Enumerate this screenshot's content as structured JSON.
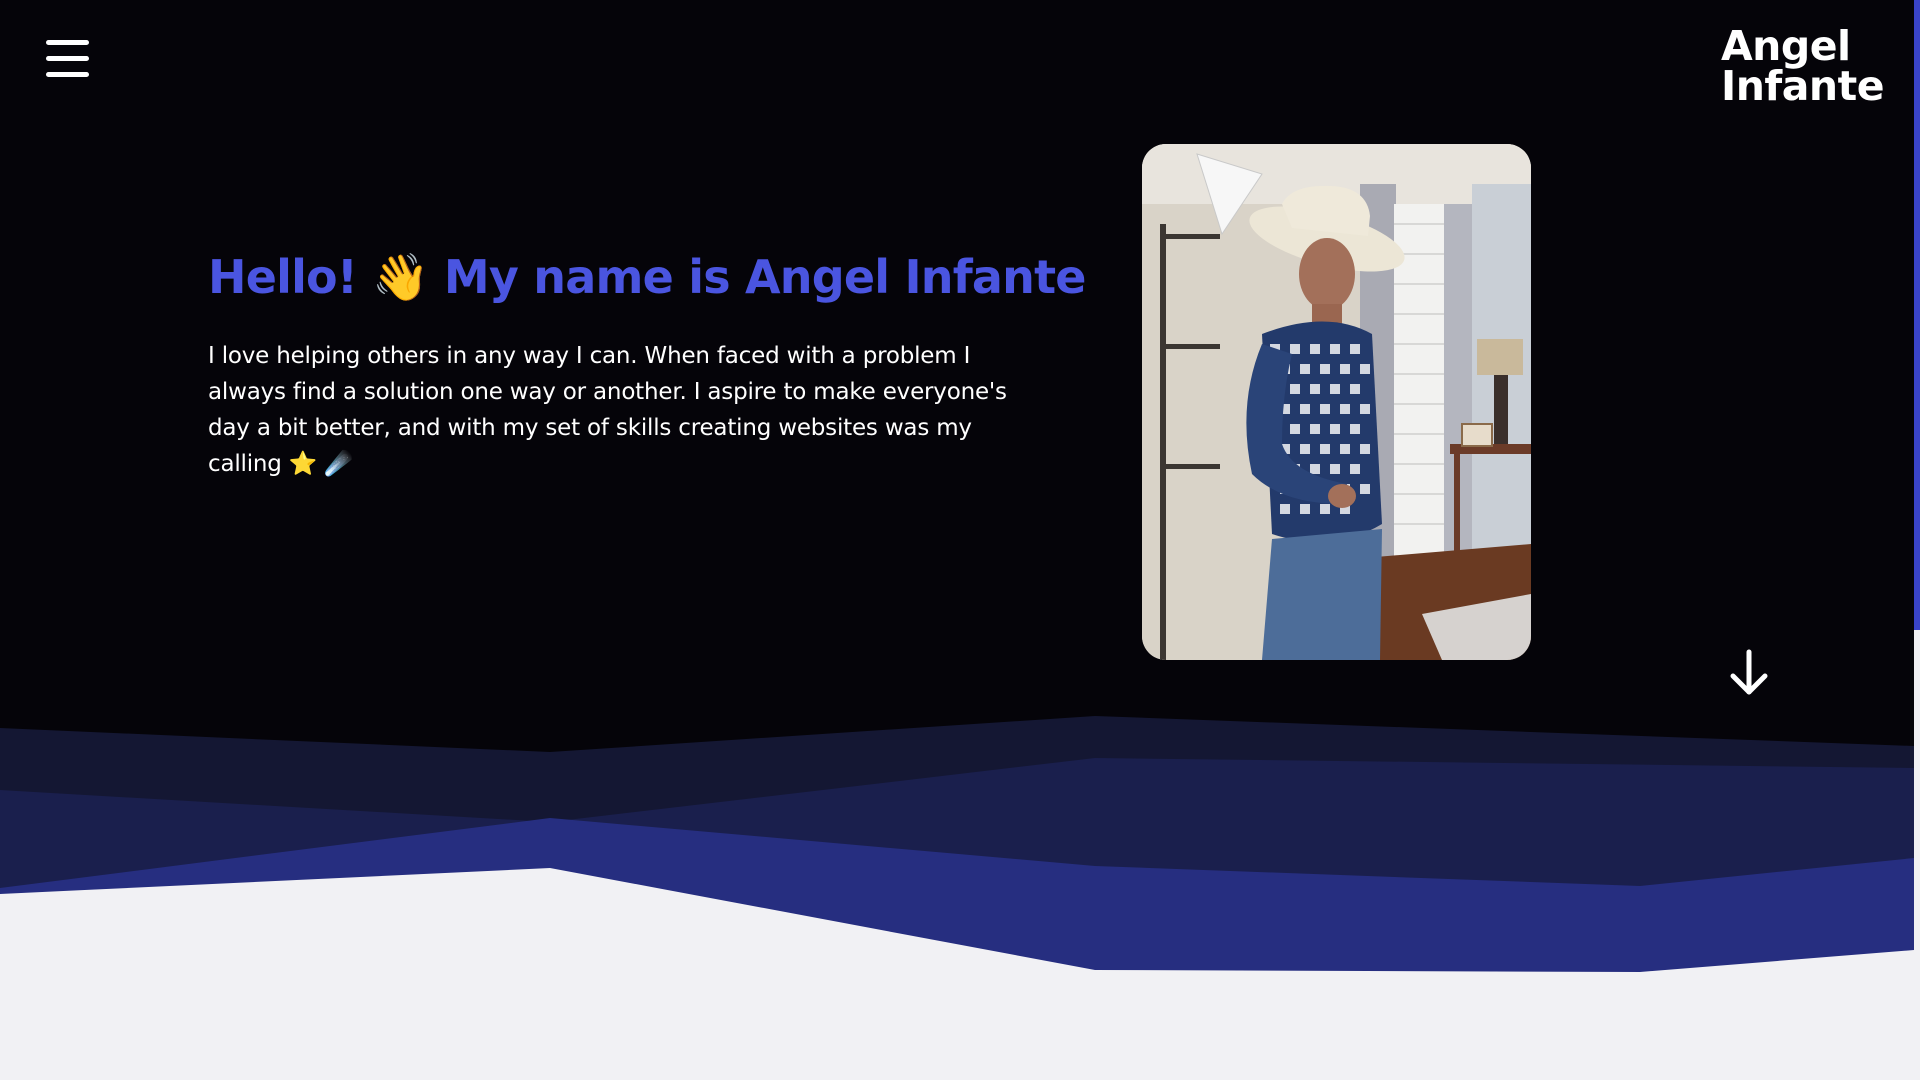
{
  "header": {
    "menu_icon": "hamburger-menu-icon",
    "logo_line1": "Angel",
    "logo_line2": "Infante"
  },
  "intro": {
    "headline": "Hello! 👋 My name is Angel Infante",
    "bio": "I love helping others in any way I can. When faced with a problem I always find a solution one way or another. I aspire to make everyone's day a bit better, and with my set of skills creating websites was my calling ⭐ ☄️"
  },
  "photo": {
    "subject": "portrait photo of a man in a white cowboy hat and blue checkered shirt"
  },
  "scroll": {
    "icon": "arrow-down-icon"
  },
  "colors": {
    "background_dark": "#050409",
    "accent": "#4a55e0",
    "wave_dark": "#141733",
    "wave_mid": "#1a1f4d",
    "wave_bright": "#262e80",
    "page_light": "#f1f1f4",
    "text": "#ffffff"
  }
}
